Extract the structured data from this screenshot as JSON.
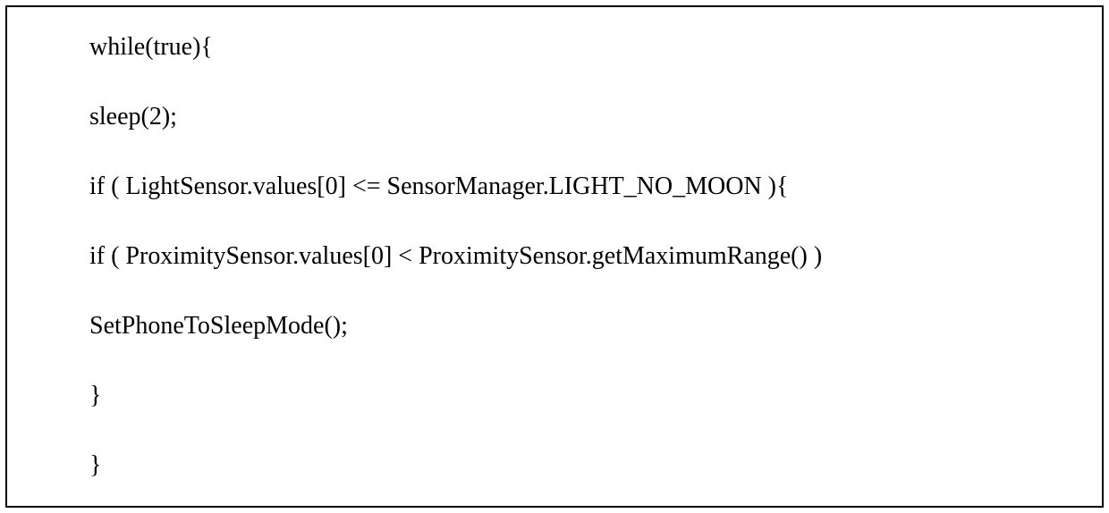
{
  "code": {
    "line1": "while(true){",
    "line2": "sleep(2);",
    "line3": "if ( LightSensor.values[0] <= SensorManager.LIGHT_NO_MOON ){",
    "line4": "if ( ProximitySensor.values[0] < ProximitySensor.getMaximumRange() )",
    "line5": "SetPhoneToSleepMode();",
    "line6": "}",
    "line7": "}"
  }
}
